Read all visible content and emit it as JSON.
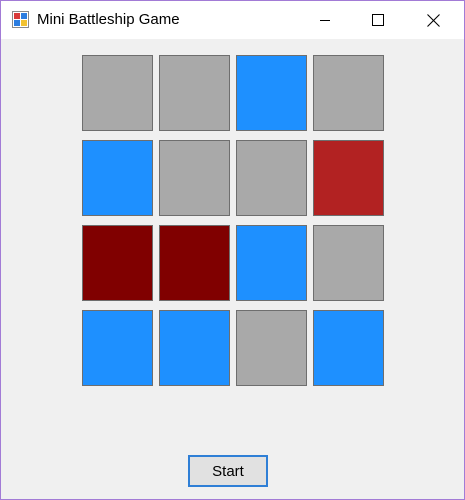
{
  "window": {
    "title": "Mini Battleship Game",
    "icon": "battleship-app-icon"
  },
  "titlebar_buttons": {
    "minimize_icon": "minimize-icon",
    "maximize_icon": "maximize-icon",
    "close_icon": "close-icon"
  },
  "colors": {
    "unrevealed": "#a9a9a9",
    "miss": "#1e90ff",
    "hit": "#b22222",
    "sunk": "#800000"
  },
  "board": {
    "rows": 4,
    "columns": 4,
    "cells": [
      [
        "unrevealed",
        "unrevealed",
        "miss",
        "unrevealed"
      ],
      [
        "miss",
        "unrevealed",
        "unrevealed",
        "hit"
      ],
      [
        "sunk",
        "sunk",
        "miss",
        "unrevealed"
      ],
      [
        "miss",
        "miss",
        "unrevealed",
        "miss"
      ]
    ]
  },
  "controls": {
    "start_label": "Start"
  }
}
